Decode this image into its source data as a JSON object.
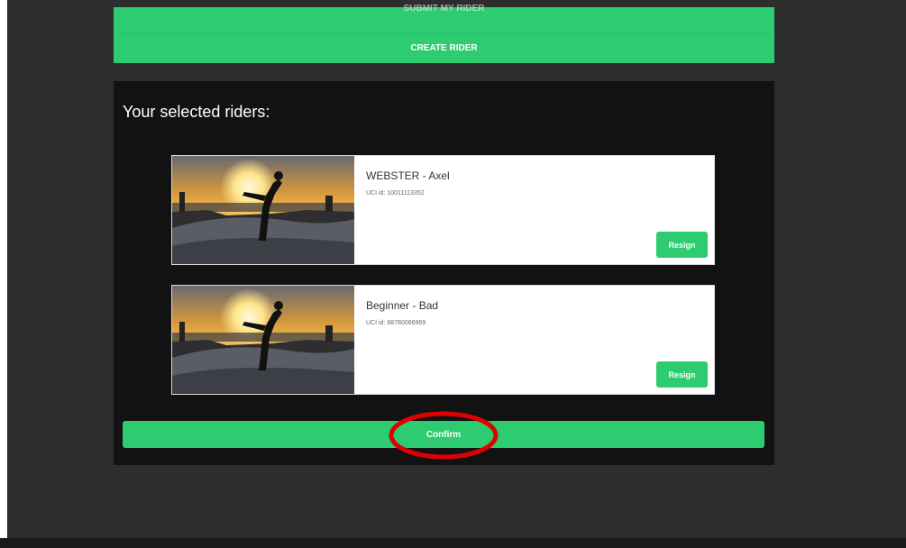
{
  "header_panel": {
    "top_button_label": "SUBMIT MY RIDER",
    "create_button_label": "CREATE RIDER"
  },
  "selected": {
    "title": "Your selected riders:",
    "riders": [
      {
        "name": "WEBSTER - Axel",
        "uci_id": "UCI id: 10011113352",
        "resign_label": "Resign"
      },
      {
        "name": "Beginner - Bad",
        "uci_id": "UCI id: 88780066969",
        "resign_label": "Resign"
      }
    ],
    "confirm_label": "Confirm"
  },
  "colors": {
    "accent": "#2ecc71",
    "background": "#2d2d2d",
    "panel": "#121212",
    "highlight": "#e00000"
  }
}
